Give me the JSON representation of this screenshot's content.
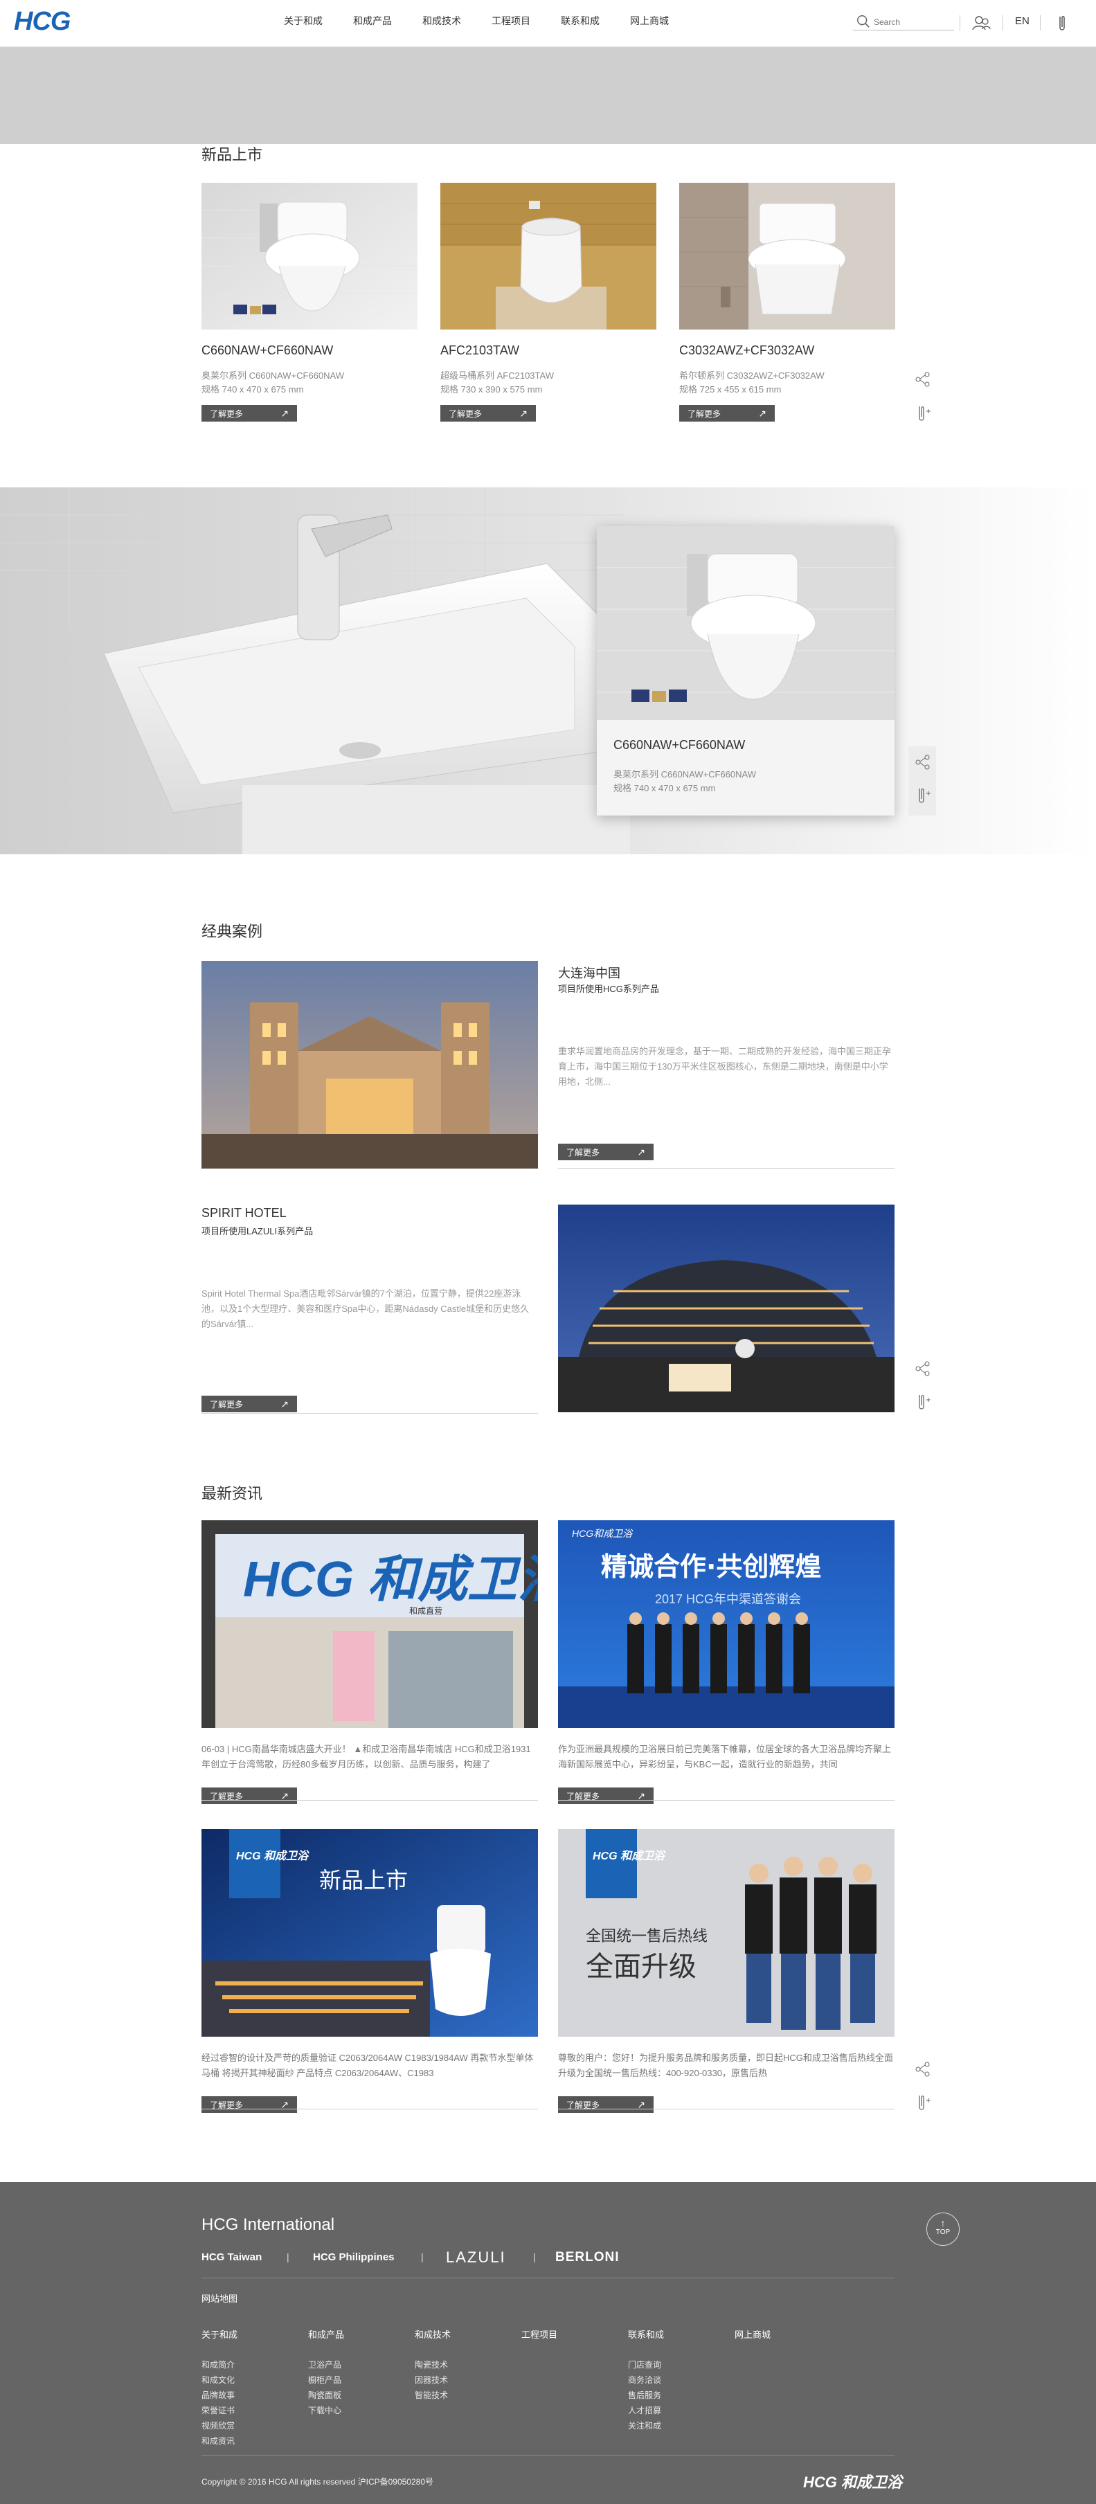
{
  "header": {
    "logo": "HCG",
    "nav": [
      "关于和成",
      "和成产品",
      "和成技术",
      "工程项目",
      "联系和成",
      "网上商城"
    ],
    "search_placeholder": "Search",
    "lang": "EN"
  },
  "new_products": {
    "title": "新品上市",
    "items": [
      {
        "name": "C660NAW+CF660NAW",
        "series": "奥莱尔系列 C660NAW+CF660NAW",
        "spec": "规格 740 x 470 x 675 mm",
        "more": "了解更多"
      },
      {
        "name": "AFC2103TAW",
        "series": "超级马桶系列 AFC2103TAW",
        "spec": "规格 730 x 390 x 575 mm",
        "more": "了解更多"
      },
      {
        "name": "C3032AWZ+CF3032AW",
        "series": "希尔顿系列 C3032AWZ+CF3032AW",
        "spec": "规格 725 x 455 x 615 mm",
        "more": "了解更多"
      }
    ]
  },
  "hero": {
    "name": "C660NAW+CF660NAW",
    "series": "奥莱尔系列 C660NAW+CF660NAW",
    "spec": "规格 740 x 470 x 675 mm"
  },
  "cases": {
    "title": "经典案例",
    "items": [
      {
        "name": "大连海中国",
        "sub": "项目所使用HCG系列产品",
        "desc": "重求华润置地商品房的开发理念，基于一期、二期成熟的开发经验，海中国三期正孕育上市，海中国三期位于130万平米住区板图核心，东侧是二期地块，南侧是中小学用地，北侧...",
        "more": "了解更多"
      },
      {
        "name": "SPIRIT HOTEL",
        "sub": "项目所使用LAZULI系列产品",
        "desc": "Spirit Hotel Thermal Spa酒店毗邻Sárvár镇的7个湖泊，位置宁静，提供22座游泳池，以及1个大型理疗、美容和医疗Spa中心，距离Nádasdy Castle城堡和历史悠久的Sárvár镇...",
        "more": "了解更多"
      }
    ]
  },
  "news": {
    "title": "最新资讯",
    "items": [
      {
        "desc": "06-03 | HCG南昌华南城店盛大开业！ ▲和成卫浴南昌华南城店 HCG和成卫浴1931年创立于台湾莺歌，历经80多载岁月历练，以创新、品质与服务，构建了",
        "more": "了解更多",
        "sign_text": "HCG 和成卫浴",
        "store_text": "和成直营"
      },
      {
        "desc": "作为亚洲最具规模的卫浴展日前已完美落下帷幕，位居全球的各大卫浴品牌均齐聚上海新国际展览中心，异彩纷呈，与KBC一起，造就行业的新趋势，共同",
        "more": "了解更多",
        "banner_title": "精诚合作·共创辉煌",
        "banner_sub": "2017 HCG年中渠道答谢会",
        "banner_logo": "HCG和成卫浴"
      },
      {
        "desc": "经过睿智的设计及严苛的质量验证 C2063/2064AW C1983/1984AW 再款节水型单体马桶 将揭开其神秘面纱 产品特点 C2063/2064AW、C1983",
        "more": "了解更多",
        "banner_title": "新品上市",
        "logo": "HCG 和成卫浴"
      },
      {
        "desc": "尊敬的用户：您好！为提升服务品牌和服务质量，即日起HCG和成卫浴售后热线全面升级为全国统一售后热线：400-920-0330，原售后热",
        "more": "了解更多",
        "banner_line1": "全国统一售后热线",
        "banner_line2": "全面升级",
        "logo": "HCG 和成卫浴"
      }
    ]
  },
  "footer": {
    "intl_title": "HCG International",
    "brands": [
      "HCG Taiwan",
      "HCG Philippines",
      "LAZULI",
      "BERLONI"
    ],
    "sitemap": "网站地图",
    "columns": [
      {
        "head": "关于和成",
        "items": [
          "和成简介",
          "和成文化",
          "品牌故事",
          "荣誉证书",
          "视频欣赏",
          "和成资讯"
        ]
      },
      {
        "head": "和成产品",
        "items": [
          "卫浴产品",
          "橱柜产品",
          "陶瓷面板",
          "下载中心"
        ]
      },
      {
        "head": "和成技术",
        "items": [
          "陶瓷技术",
          "因器技术",
          "智能技术"
        ]
      },
      {
        "head": "工程项目",
        "items": []
      },
      {
        "head": "联系和成",
        "items": [
          "门店查询",
          "商务洽谈",
          "售后服务",
          "人才招募",
          "关注和成"
        ]
      },
      {
        "head": "网上商城",
        "items": []
      }
    ],
    "copyright": "Copyright © 2016 HCG All rights reserved 沪ICP备09050280号",
    "logo": "HCG 和成卫浴",
    "top": "TOP"
  },
  "colors": {
    "brand_blue": "#1a63b5",
    "footer_bg": "#656565",
    "button_dark": "#555555",
    "gray_band": "#cfcfcf"
  }
}
